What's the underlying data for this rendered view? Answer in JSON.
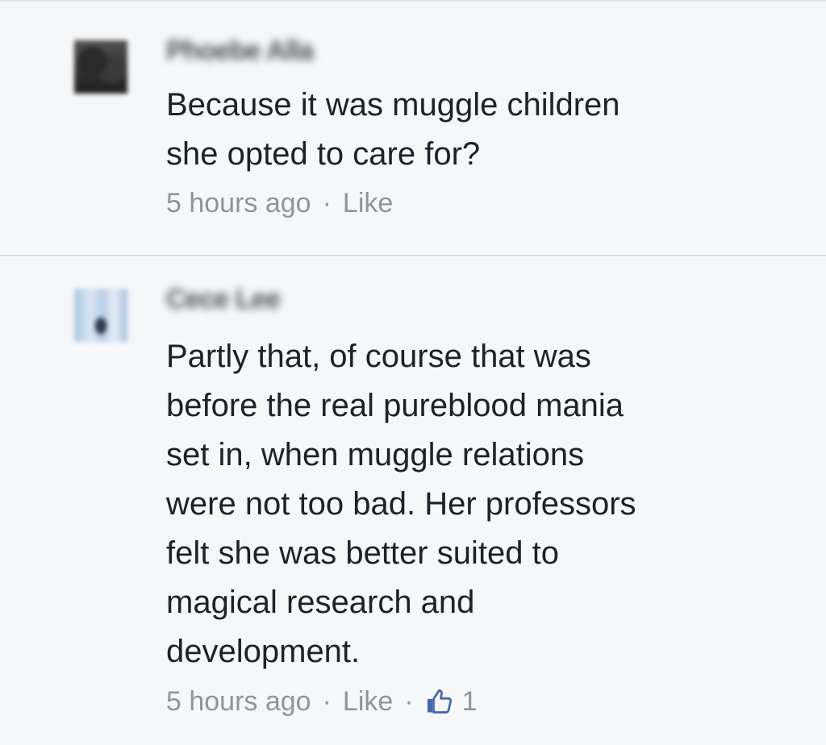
{
  "comments": [
    {
      "author": "Phoebe Alla",
      "text": "Because it was muggle children\nshe opted to care for?",
      "time": "5 hours ago",
      "separator": "·",
      "like_label": "Like"
    },
    {
      "author": "Cece Lee",
      "text": "Partly that, of course that was\nbefore the real pureblood mania\nset in, when muggle relations\nwere not too bad. Her professors\nfelt she was better suited to\nmagical research and\ndevelopment.",
      "time": "5 hours ago",
      "separator": "·",
      "like_label": "Like",
      "like_count": "1"
    }
  ],
  "colors": {
    "background": "#f6f7f9",
    "text": "#1d2129",
    "meta": "#90949c",
    "like_blue": "#4267b2"
  },
  "icons": {
    "reaction": "thumbs-up-icon"
  }
}
